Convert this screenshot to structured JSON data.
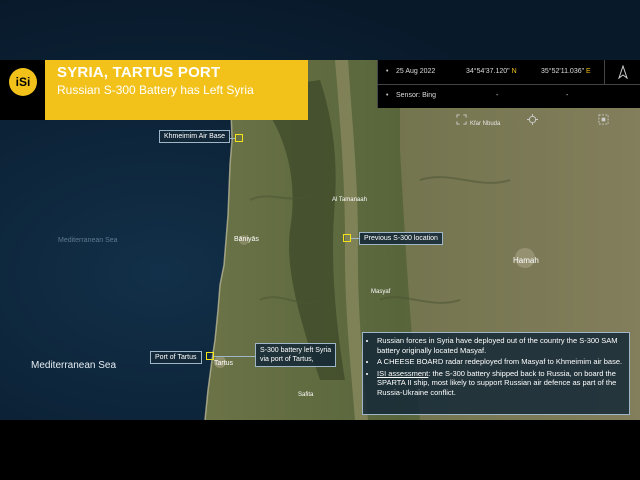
{
  "header": {
    "logo_text": "iSi",
    "title": "SYRIA, TARTUS PORT",
    "subtitle": "Russian S-300 Battery has Left Syria"
  },
  "info_panel": {
    "date": "25 Aug 2022",
    "lat": "34°54'37.120\"",
    "lat_hemi": "N",
    "lon": "35°52'11.036\"",
    "lon_hemi": "E",
    "sensor": "Sensor: Bing",
    "dash1": "-",
    "dash2": "-",
    "icons": [
      "north-arrow-icon",
      "expand-icon",
      "crosshair-icon",
      "grid-icon"
    ]
  },
  "map": {
    "place_labels": {
      "mediterranean_sea": "Mediterranean Sea",
      "mediterranean_sea_faint": "Mediterranean Sea",
      "baniyas": "Bāniyās",
      "tartus": "Tartus",
      "safita": "Safita",
      "masyaf": "Masyaf",
      "hamah": "Hamah",
      "al_tamaniah": "Al Tamanaah",
      "kfar_nbuda": "Kfar Nbuda"
    },
    "callouts": {
      "khmeimim": "Khmeimim Air Base",
      "previous_location": "Previous S-300 location",
      "port_of_tartus": "Port of Tartus",
      "left_syria_line1": "S-300 battery left Syria",
      "left_syria_line2": "via port of Tartus,"
    }
  },
  "info_box": {
    "bullet1": "Russian forces in Syria have deployed out of the country the S-300 SAM battery originally located Masyaf.",
    "bullet2": "A CHEESE BOARD radar redeployed from Masyaf to Khmeimim air base.",
    "bullet3_label": "ISI assessment",
    "bullet3_text": ": the S-300 battery shipped back to Russia, on board the SPARTA II ship, most likely to support Russian air defence as part of the Russia-Ukraine conflict."
  },
  "colors": {
    "accent_yellow": "#f2c21b",
    "sea": "#0d2235",
    "land": "#5e6a3f",
    "callout_bg": "#142837",
    "target": "#f5e31a"
  }
}
